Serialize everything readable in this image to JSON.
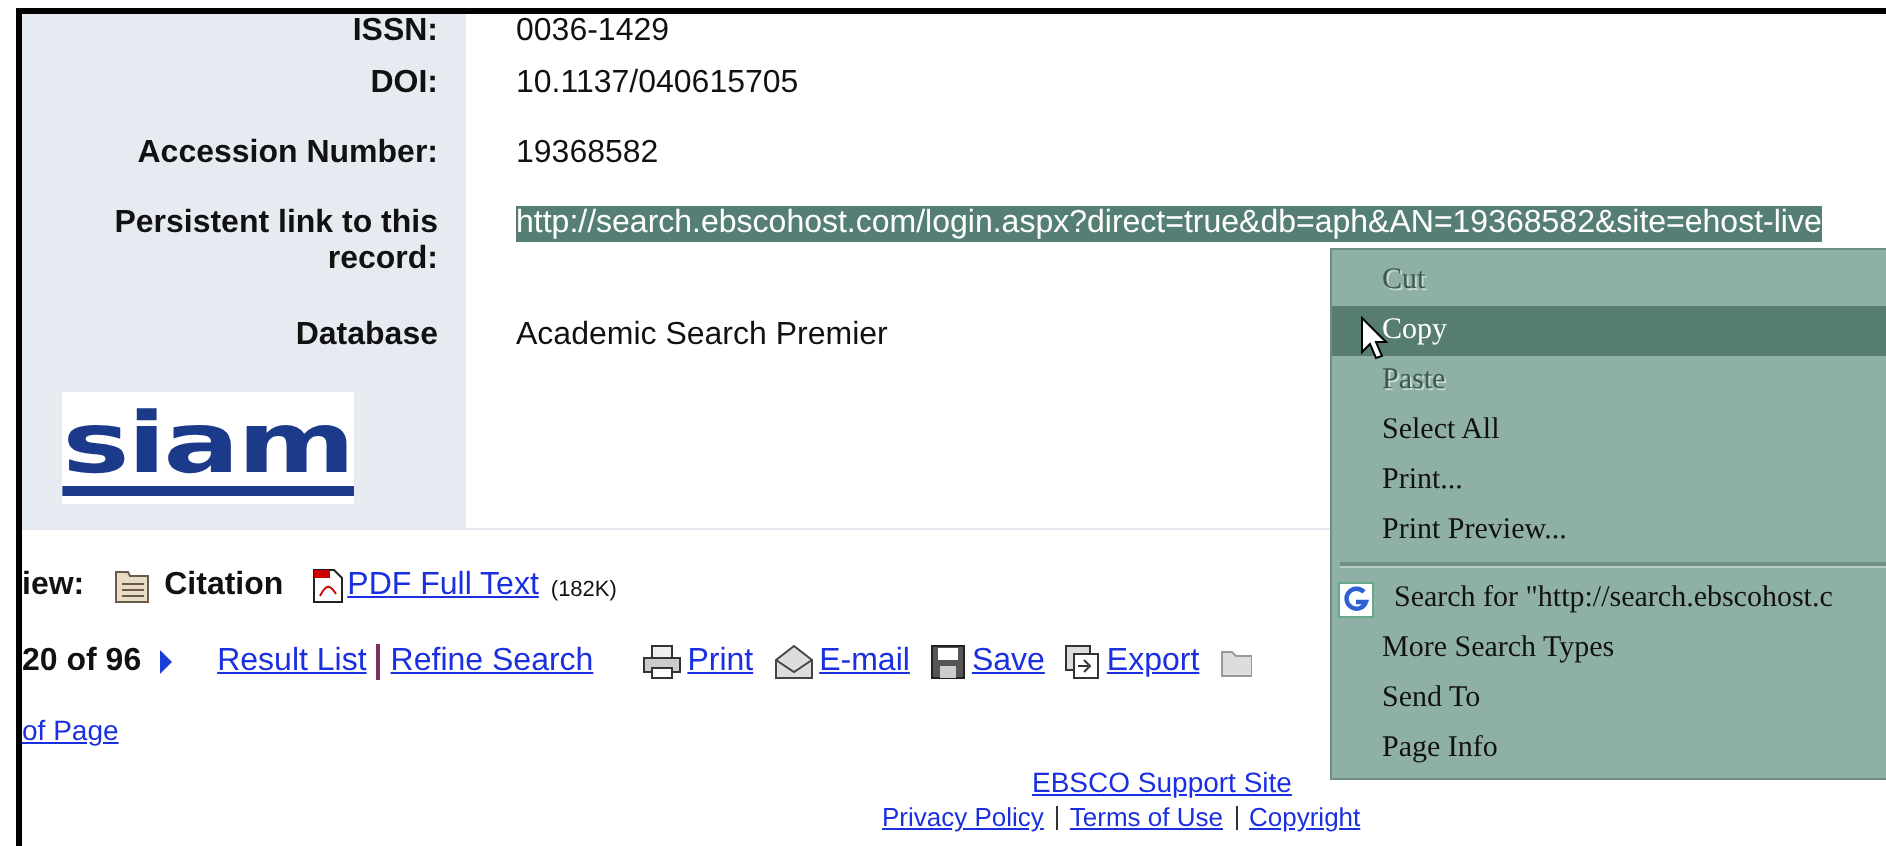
{
  "record_fields": [
    {
      "label": "ISSN:",
      "value": "0036-1429",
      "selected": false
    },
    {
      "label": "DOI:",
      "value": "10.1137/040615705",
      "selected": false
    },
    {
      "label": "Accession Number:",
      "value": "19368582",
      "selected": false
    },
    {
      "label": "Persistent link to this record:",
      "value": "http://search.ebscohost.com/login.aspx?direct=true&db=aph&AN=19368582&site=ehost-live",
      "selected": true
    },
    {
      "label": "Database",
      "value": "Academic Search Premier",
      "selected": false
    }
  ],
  "logo": "siam",
  "view_bar": {
    "label": "iew:",
    "items": [
      {
        "kind": "plain",
        "label": "Citation"
      },
      {
        "kind": "link",
        "label": "PDF Full Text",
        "size": "(182K)"
      }
    ]
  },
  "nav": {
    "position": "20 of 96",
    "links": [
      "Result List",
      "Refine Search"
    ],
    "actions": [
      {
        "kind": "print",
        "label": "Print"
      },
      {
        "kind": "email",
        "label": "E-mail"
      },
      {
        "kind": "save",
        "label": "Save"
      },
      {
        "kind": "export",
        "label": "Export"
      }
    ]
  },
  "top_link": "of Page",
  "support_link": "EBSCO Support Site",
  "footer_links": [
    "Privacy Policy",
    "Terms of Use",
    "Copyright"
  ],
  "context_menu": {
    "items": [
      {
        "kind": "item",
        "label": "Cut",
        "disabled": true,
        "selected": false
      },
      {
        "kind": "item",
        "label": "Copy",
        "disabled": false,
        "selected": true
      },
      {
        "kind": "item",
        "label": "Paste",
        "disabled": true,
        "selected": false
      },
      {
        "kind": "item",
        "label": "Select All",
        "disabled": false,
        "selected": false
      },
      {
        "kind": "item",
        "label": "Print...",
        "disabled": false,
        "selected": false
      },
      {
        "kind": "item",
        "label": "Print Preview...",
        "disabled": false,
        "selected": false
      },
      {
        "kind": "separator"
      },
      {
        "kind": "search",
        "label": "Search for \"http://search.ebscohost.c",
        "disabled": false,
        "selected": false
      },
      {
        "kind": "item",
        "label": "More Search Types",
        "disabled": false,
        "selected": false
      },
      {
        "kind": "item",
        "label": "Send To",
        "disabled": false,
        "selected": false
      },
      {
        "kind": "item",
        "label": "Page Info",
        "disabled": false,
        "selected": false
      }
    ]
  }
}
